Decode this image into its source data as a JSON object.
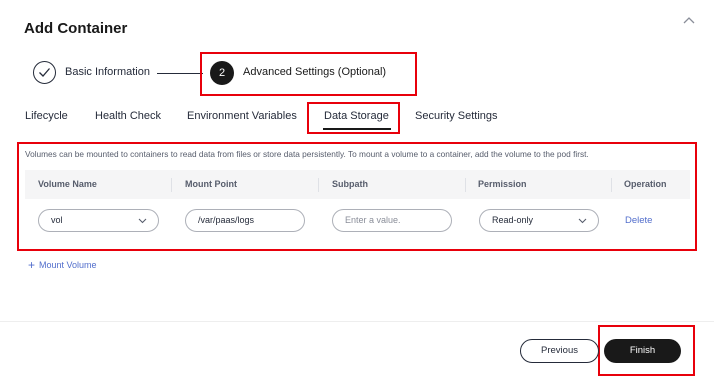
{
  "dialog": {
    "title": "Add Container"
  },
  "steps": [
    {
      "label": "Basic Information",
      "state": "done"
    },
    {
      "number": "2",
      "label": "Advanced Settings (Optional)",
      "state": "active"
    }
  ],
  "tabs": [
    {
      "label": "Lifecycle"
    },
    {
      "label": "Health Check"
    },
    {
      "label": "Environment Variables"
    },
    {
      "label": "Data Storage",
      "active": true
    },
    {
      "label": "Security Settings"
    }
  ],
  "data_storage": {
    "description": "Volumes can be mounted to containers to read data from files or store data persistently. To mount a volume to a container, add the volume to the pod first.",
    "columns": [
      "Volume Name",
      "Mount Point",
      "Subpath",
      "Permission",
      "Operation"
    ],
    "rows": [
      {
        "volume_name": "vol",
        "mount_point": "/var/paas/logs",
        "subpath_placeholder": "Enter a value.",
        "permission": "Read-only",
        "operation": "Delete"
      }
    ],
    "add_label": "Mount Volume"
  },
  "footer": {
    "previous": "Previous",
    "finish": "Finish"
  },
  "colors": {
    "accent_link": "#526ecc",
    "primary_button": "#191919",
    "highlight_box": "#e8000b"
  }
}
